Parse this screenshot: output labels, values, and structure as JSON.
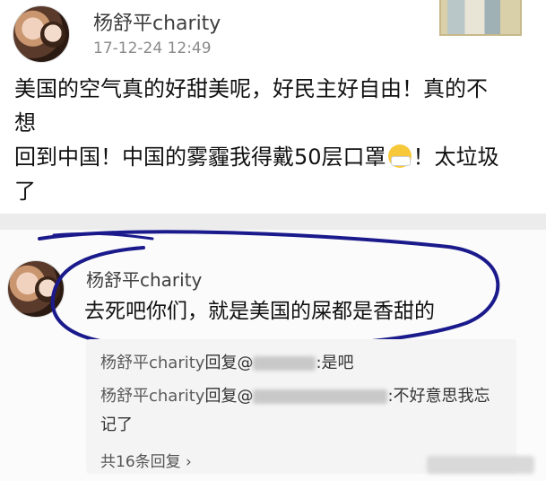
{
  "post": {
    "username": "杨舒平charity",
    "timestamp": "17-12-24 12:49",
    "lines": [
      "美国的空气真的好甜美呢，好民主好自由！真的不",
      "想",
      "回到中国！中国的雾霾我得戴50层口罩",
      "！太垃圾",
      "了"
    ],
    "emoji": "mask-emoji"
  },
  "reply": {
    "username": "杨舒平charity",
    "text": "去死吧你们，就是美国的屎都是香甜的",
    "subreplies": [
      {
        "name": "杨舒平charity",
        "verb": "回复@",
        "text": ":是吧"
      },
      {
        "name": "杨舒平charity",
        "verb": "回复@",
        "text": ":不好意思我忘记了"
      }
    ],
    "more_label": "共16条回复 ›"
  },
  "colors": {
    "circle": "#1a1a8c",
    "background": "#ececec"
  }
}
